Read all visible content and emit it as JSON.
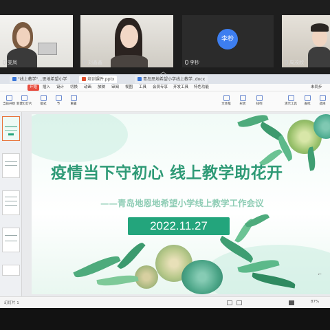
{
  "meeting": {
    "participants": [
      {
        "name": "雯凤"
      },
      {
        "name": "刘鑫鑫"
      },
      {
        "name": "李杪",
        "avatar_text": "李杪"
      },
      {
        "name": "周茂欣"
      }
    ],
    "collapse_icon": "chevron-up-icon"
  },
  "wps": {
    "tabs": [
      {
        "label": "\"线上教学\"…思地希望小学"
      },
      {
        "label": "培训课件.pptx"
      },
      {
        "label": "青岛思地希望小学线上教学..docx"
      }
    ],
    "menu": [
      "开始",
      "插入",
      "设计",
      "切换",
      "动画",
      "放映",
      "审阅",
      "视图",
      "工具",
      "会员专享",
      "开发工具",
      "特色功能"
    ],
    "menu_right": "未同步",
    "ribbon": [
      "当前开始",
      "新建幻灯片",
      "版式",
      "节",
      "重置",
      "文本框",
      "形状",
      "排列",
      "演示工具",
      "查找",
      "选择"
    ],
    "status_left": "幻灯片 1",
    "status_right": "87%"
  },
  "slide": {
    "title": "疫情当下守初心 线上教学助花开",
    "subtitle": "——青岛地恩地希望小学线上教学工作会议",
    "date": "2022.11.27"
  },
  "colors": {
    "accent_green": "#23a57c",
    "title_green": "#2e9a76",
    "wps_red": "#e74a3c"
  }
}
